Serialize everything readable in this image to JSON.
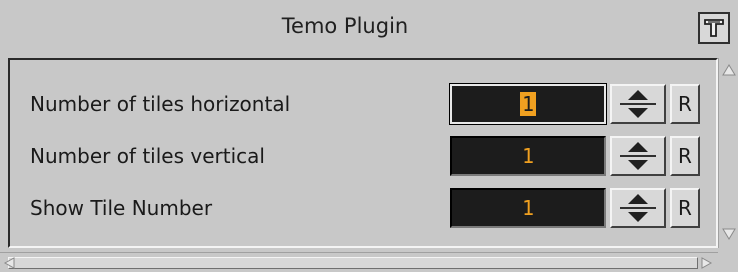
{
  "window": {
    "title": "Temo Plugin",
    "corner_icon": "plugin-menu-icon"
  },
  "rows": [
    {
      "label": "Number of tiles horizontal",
      "value": "1",
      "focused": true,
      "reset_label": "R"
    },
    {
      "label": "Number of tiles vertical",
      "value": "1",
      "focused": false,
      "reset_label": "R"
    },
    {
      "label": "Show Tile Number",
      "value": "1",
      "focused": false,
      "reset_label": "R"
    }
  ],
  "colors": {
    "background": "#c8c8c8",
    "value_text": "#f0a020",
    "value_bg": "#1c1c1c"
  }
}
